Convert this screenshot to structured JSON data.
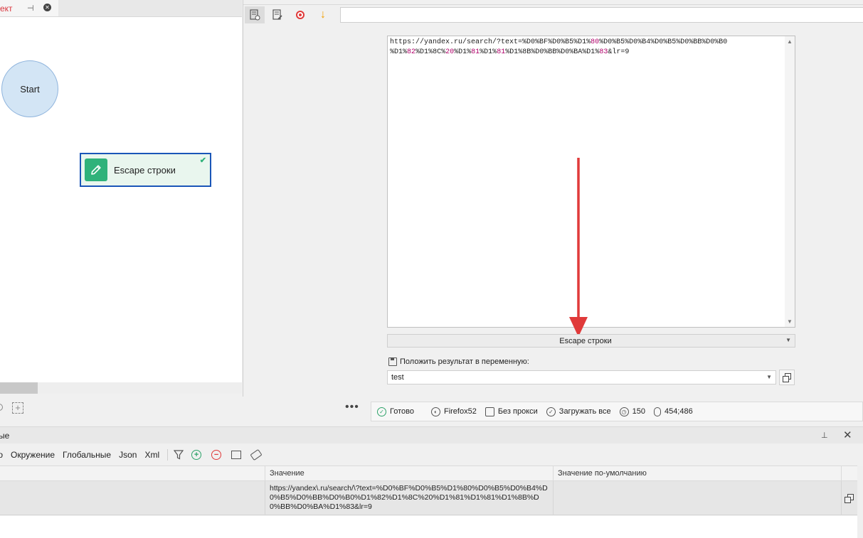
{
  "left_panel": {
    "tab_title": "ект",
    "nodes": {
      "start_label": "Start",
      "action_label": "Escape строки"
    }
  },
  "editor": {
    "text_line1": "https://yandex.ru/search/?text=%D0%BF%D0%B5%D1%80%D0%B5%D0%B4%D0%B5%D0%BB%D0%B0",
    "text_line2": "%D1%82%D1%8C%20%D1%81%D1%81%D1%8B%D0%BB%D0%BA%D1%83&lr=9",
    "action_select": "Escape строки",
    "save_label": "Положить результат в переменную:",
    "variable_name": "test"
  },
  "statusbar": {
    "ready": "Готово",
    "browser": "Firefox52",
    "proxy": "Без прокси",
    "load": "Загружать все",
    "timeout": "150",
    "coords": "454;486"
  },
  "variables_panel": {
    "title": "ые",
    "tabs": [
      "то",
      "Окружение",
      "Глобальные",
      "Json",
      "Xml"
    ],
    "columns": {
      "value": "Значение",
      "default": "Значение по-умолчанию"
    },
    "row": {
      "value": "https://yandex\\.ru/search/\\?text=%D0%BF%D0%B5%D1%80%D0%B5%D0%B4%D0%B5%D0%BB%D0%B0%D1%82%D1%8C%20%D1%81%D1%81%D1%8B%D0%BB%D0%BA%D1%83&lr=9",
      "default": ""
    }
  },
  "colors": {
    "accent_red": "#e03a3a",
    "accent_green": "#2fb27a",
    "node_border": "#1a56b8",
    "start_fill": "#d3e5f5",
    "numeric_highlight": "#b0006a"
  }
}
